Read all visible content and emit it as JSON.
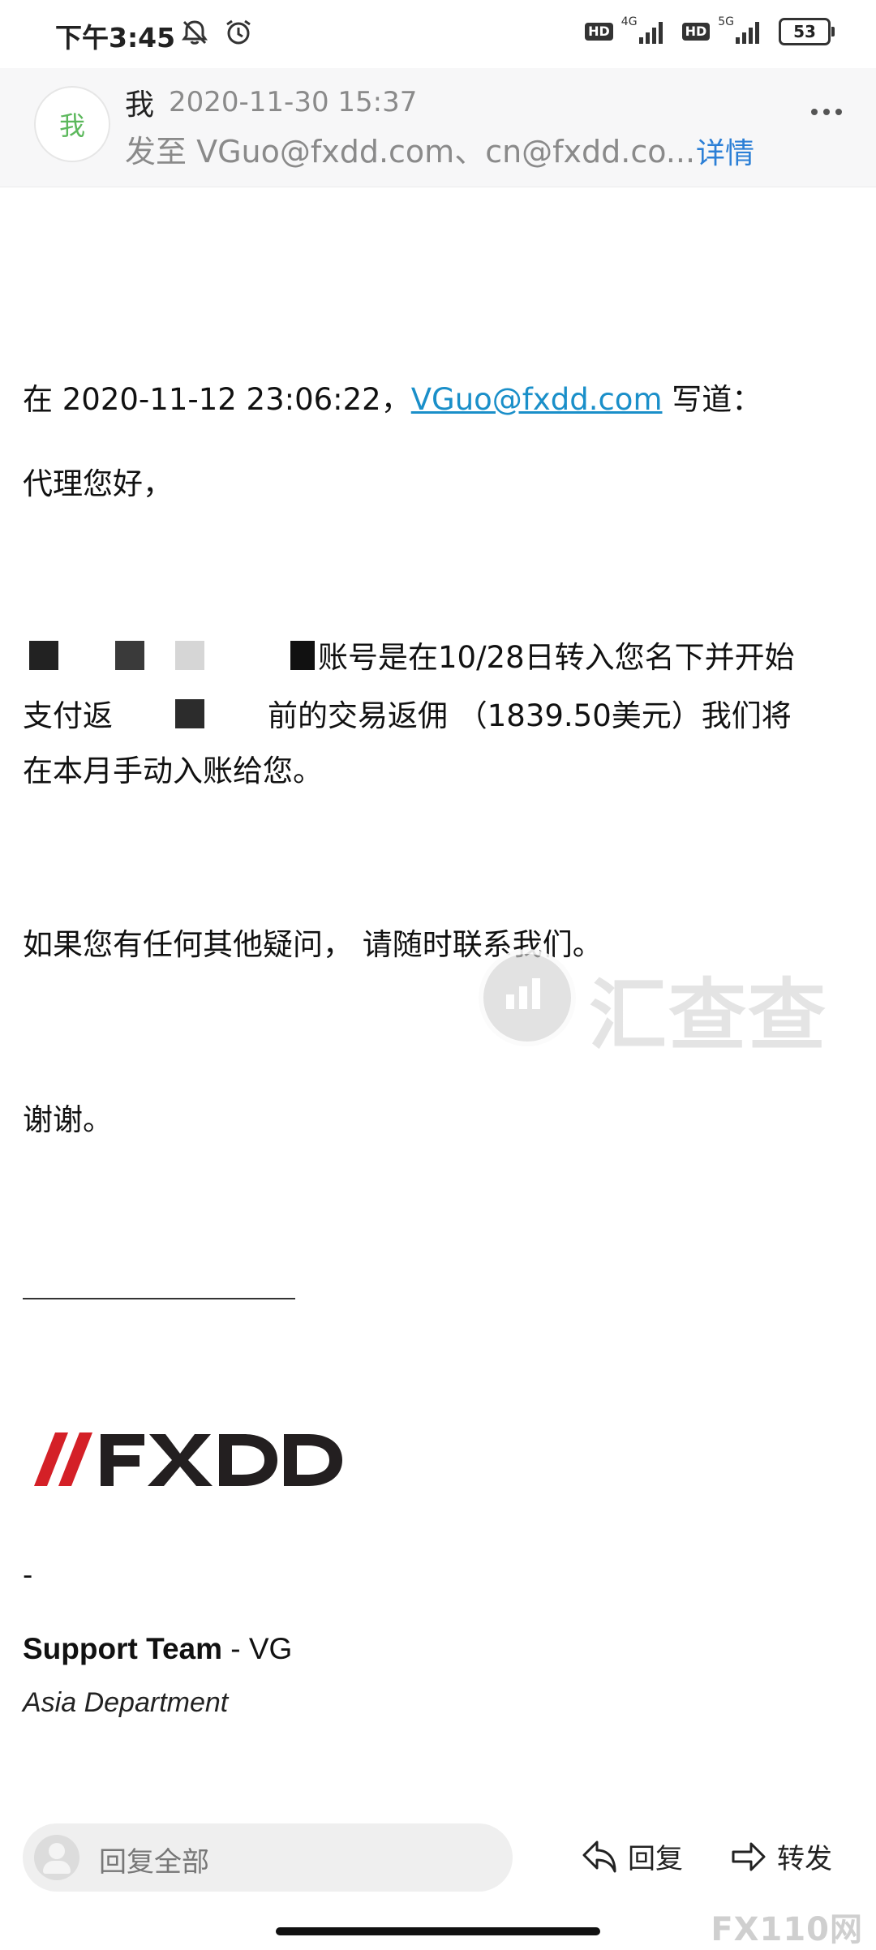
{
  "status_bar": {
    "time": "下午3:45",
    "icons": [
      "mute-icon",
      "alarm-icon",
      "hd-icon",
      "signal-4g-icon",
      "hd-icon",
      "signal-5g-icon"
    ],
    "net1": "4G",
    "net2": "5G",
    "hd": "HD",
    "battery": "53"
  },
  "header": {
    "avatar_char": "我",
    "sender": "我",
    "date": "2020-11-30 15:37",
    "recipients": "发至 VGuo@fxdd.com、cn@fxdd.co...",
    "details_label": "详情"
  },
  "body": {
    "quote_prefix": "在 2020-11-12 23:06:22，",
    "quote_email": "VGuo@fxdd.com",
    "quote_suffix": " 写道：",
    "greeting": "代理您好，",
    "para1_line1": "账号是在10/28日转入您名下并开始",
    "para1_line2_a": "支付返",
    "para1_line2_b": "前的交易返佣 （1839.50美元）我们将",
    "para1_line3": "在本月手动入账给您。",
    "contact": "如果您有任何其他疑问， 请随时联系我们。",
    "thanks": "谢谢。"
  },
  "signature": {
    "logo_text": "FXDD",
    "dash": "-",
    "team_bold": "Support Team",
    "team_rest": " - VG",
    "department": "Asia Department"
  },
  "watermark": {
    "text": "汇查查",
    "corner": "FX110网"
  },
  "bottom_bar": {
    "reply_all": "回复全部",
    "reply": "回复",
    "forward": "转发"
  },
  "colors": {
    "link": "#1a8fc9",
    "details": "#2b7fd6",
    "logo_red": "#d42027",
    "logo_dark": "#231f20"
  }
}
